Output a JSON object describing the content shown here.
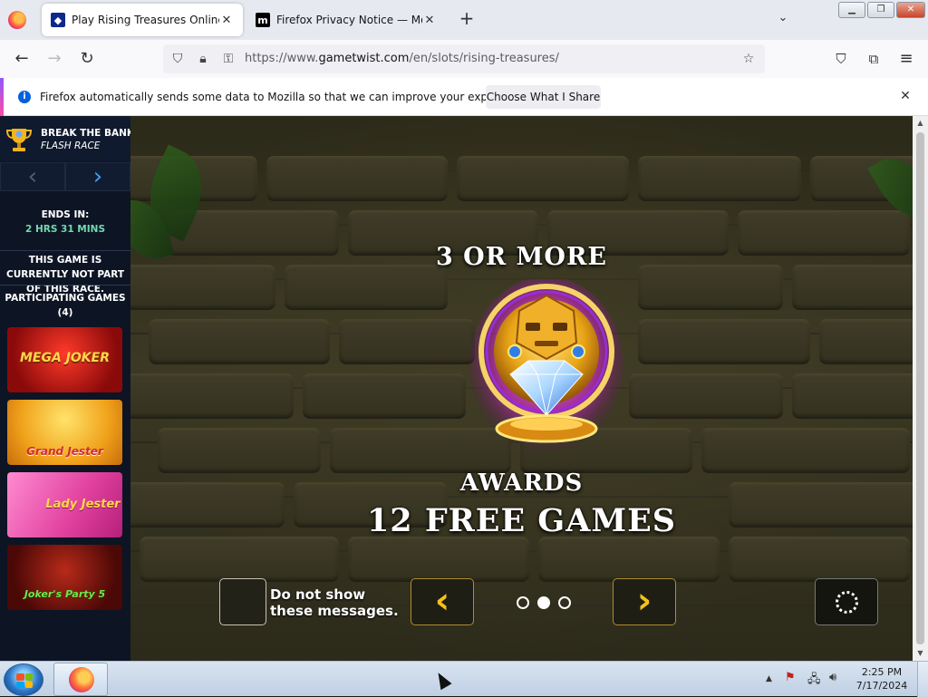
{
  "browser": {
    "tabs": [
      {
        "title": "Play Rising Treasures Online FREE",
        "active": true,
        "favicon": "gametwist-icon"
      },
      {
        "title": "Firefox Privacy Notice — Mozilla",
        "active": false,
        "favicon": "mozilla-icon"
      }
    ],
    "url_prefix": "https://www.",
    "url_host": "gametwist.com",
    "url_path": "/en/slots/rising-treasures/",
    "notification": {
      "message": "Firefox automatically sends some data to Mozilla so that we can improve your experience.",
      "button": "Choose What I Share"
    }
  },
  "race": {
    "title": "BREAK THE BANK",
    "subtitle": "FLASH RACE",
    "ends_label": "ENDS IN:",
    "ends_value": "2 HRS 31 MINS",
    "not_part": "THIS GAME IS CURRENTLY NOT PART OF THIS RACE.",
    "participating_label": "PARTICIPATING GAMES",
    "participating_count": "(4)",
    "games": [
      {
        "name": "MEGA JOKER"
      },
      {
        "name": "Grand Jester"
      },
      {
        "name": "Lady Jester"
      },
      {
        "name": "Joker's Party 5"
      }
    ]
  },
  "game": {
    "heading_top": "3 OR MORE",
    "heading_awards": "AWARDS",
    "heading_free": "12 FREE GAMES",
    "dont_show_label": "Do not show these messages.",
    "page_index": 2,
    "page_count": 3
  },
  "taskbar": {
    "time": "2:25 PM",
    "date": "7/17/2024"
  },
  "colors": {
    "accent_gold": "#f3c11b",
    "sidebar_bg": "#0d1424",
    "ends_green": "#74d8b0"
  }
}
